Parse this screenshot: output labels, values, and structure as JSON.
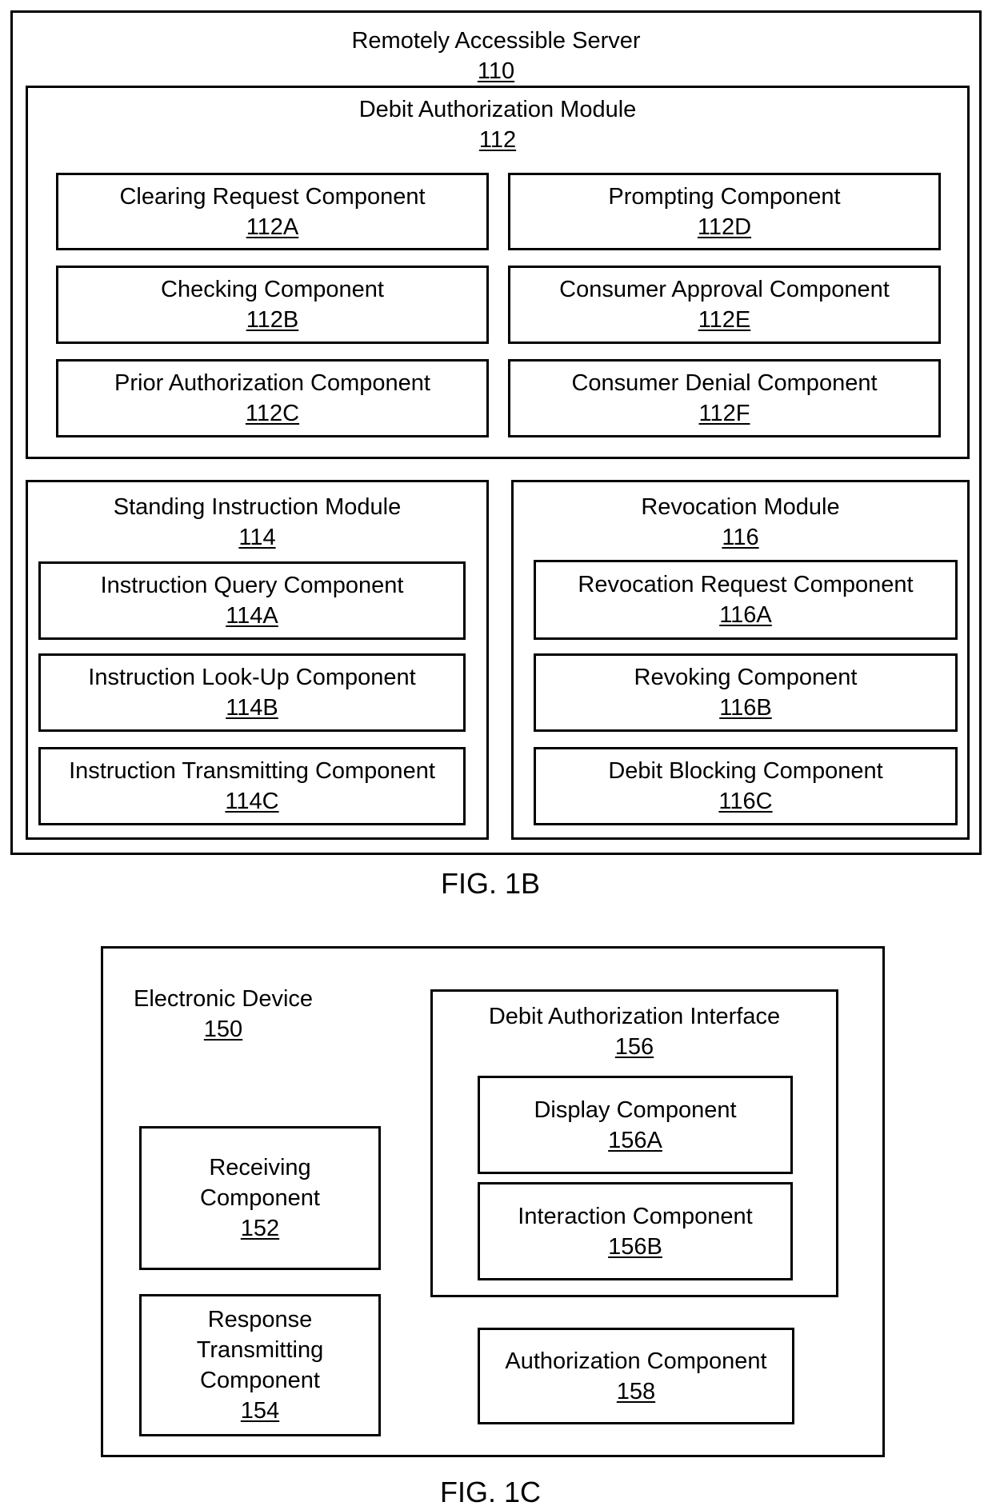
{
  "fig1b": {
    "caption": "FIG. 1B",
    "server": {
      "title": "Remotely Accessible Server",
      "ref": "110"
    },
    "debit_authorization_module": {
      "title": "Debit Authorization Module",
      "ref": "112",
      "components": [
        {
          "name": "Clearing Request Component",
          "ref": "112A"
        },
        {
          "name": "Prompting Component",
          "ref": "112D"
        },
        {
          "name": "Checking Component",
          "ref": "112B"
        },
        {
          "name": "Consumer Approval Component",
          "ref": "112E"
        },
        {
          "name": "Prior Authorization Component",
          "ref": "112C"
        },
        {
          "name": "Consumer Denial Component",
          "ref": "112F"
        }
      ]
    },
    "standing_instruction_module": {
      "title": "Standing Instruction Module",
      "ref": "114",
      "components": [
        {
          "name": "Instruction Query Component",
          "ref": "114A"
        },
        {
          "name": "Instruction Look-Up Component",
          "ref": "114B"
        },
        {
          "name": "Instruction Transmitting Component",
          "ref": "114C"
        }
      ]
    },
    "revocation_module": {
      "title": "Revocation Module",
      "ref": "116",
      "components": [
        {
          "name": "Revocation Request Component",
          "ref": "116A"
        },
        {
          "name": "Revoking Component",
          "ref": "116B"
        },
        {
          "name": "Debit Blocking Component",
          "ref": "116C"
        }
      ]
    }
  },
  "fig1c": {
    "caption": "FIG. 1C",
    "device": {
      "title": "Electronic Device",
      "ref": "150"
    },
    "receiving": {
      "lines": [
        "Receiving",
        "Component"
      ],
      "ref": "152"
    },
    "response_transmitting": {
      "lines": [
        "Response",
        "Transmitting",
        "Component"
      ],
      "ref": "154"
    },
    "interface": {
      "title": "Debit Authorization Interface",
      "ref": "156",
      "components": [
        {
          "name": "Display Component",
          "ref": "156A"
        },
        {
          "name": "Interaction Component",
          "ref": "156B"
        }
      ]
    },
    "authorization": {
      "name": "Authorization Component",
      "ref": "158"
    }
  }
}
